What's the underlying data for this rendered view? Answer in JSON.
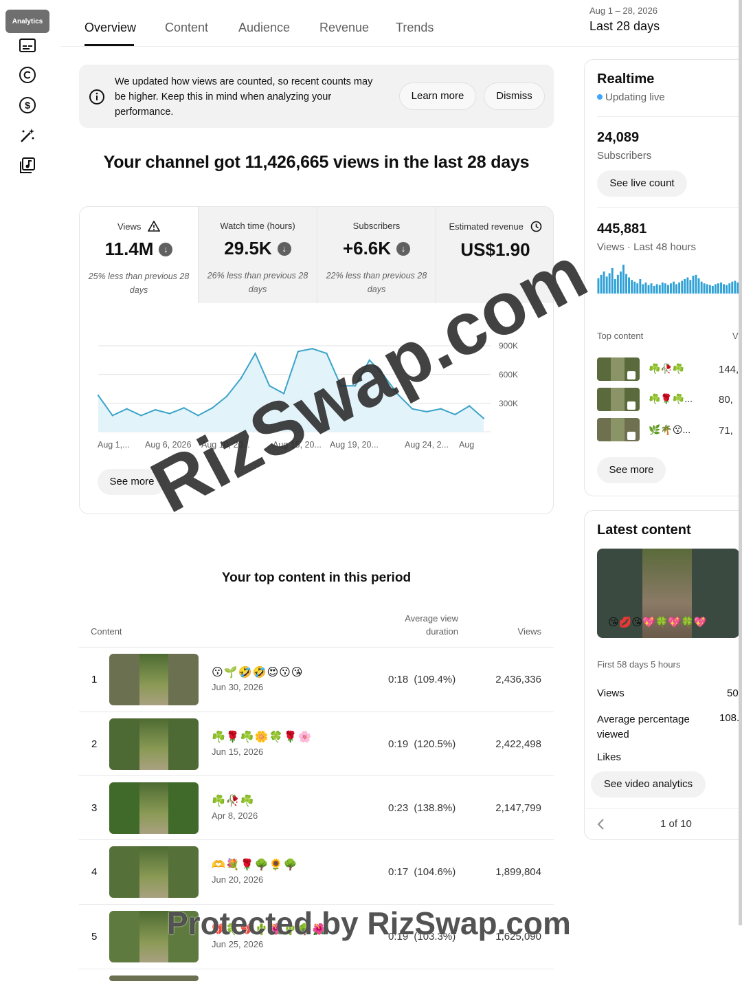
{
  "nav": {
    "active_label": "Analytics"
  },
  "tabs": [
    "Overview",
    "Content",
    "Audience",
    "Revenue",
    "Trends"
  ],
  "date_range": {
    "range": "Aug 1 – 28, 2026",
    "label": "Last 28 days"
  },
  "notice": {
    "text": "We updated how views are counted, so recent counts may be higher. Keep this in mind when analyzing your performance.",
    "learn_more": "Learn more",
    "dismiss": "Dismiss"
  },
  "headline": "Your channel got 11,426,665 views in the last 28 days",
  "metrics": [
    {
      "label": "Views",
      "value": "11.4M",
      "compare": "25% less than previous 28 days"
    },
    {
      "label": "Watch time (hours)",
      "value": "29.5K",
      "compare": "26% less than previous 28 days"
    },
    {
      "label": "Subscribers",
      "value": "+6.6K",
      "compare": "22% less than previous 28 days"
    },
    {
      "label": "Estimated revenue",
      "value": "US$1.90",
      "compare": ""
    }
  ],
  "chart_data": {
    "type": "area",
    "x": [
      "Aug 1",
      "Aug 2",
      "Aug 3",
      "Aug 4",
      "Aug 5",
      "Aug 6",
      "Aug 7",
      "Aug 8",
      "Aug 9",
      "Aug 10",
      "Aug 11",
      "Aug 12",
      "Aug 13",
      "Aug 14",
      "Aug 15",
      "Aug 16",
      "Aug 17",
      "Aug 18",
      "Aug 19",
      "Aug 20",
      "Aug 21",
      "Aug 22",
      "Aug 23",
      "Aug 24",
      "Aug 25",
      "Aug 26",
      "Aug 27",
      "Aug 28"
    ],
    "values": [
      380000,
      170000,
      240000,
      170000,
      230000,
      190000,
      250000,
      170000,
      250000,
      370000,
      560000,
      820000,
      480000,
      400000,
      840000,
      870000,
      820000,
      480000,
      480000,
      750000,
      590000,
      390000,
      240000,
      210000,
      240000,
      180000,
      270000,
      140000
    ],
    "ylim": [
      0,
      900000
    ],
    "yticks": [
      "900K",
      "600K",
      "300K"
    ],
    "xtick_labels": [
      "Aug 1,...",
      "Aug 6, 2026",
      "Aug 10, 20...",
      "Aug 15, 20...",
      "Aug 19, 20...",
      "Aug 24, 2...",
      "Aug"
    ],
    "grid": true
  },
  "chart_see_more": "See more",
  "top_content": {
    "title": "Your top content in this period",
    "headers": {
      "content": "Content",
      "avg": "Average view duration",
      "views": "Views"
    },
    "rows": [
      {
        "rank": "1",
        "title": "😗🌱🤣🤣😍😗😘",
        "date": "Jun 30, 2026",
        "duration": "0:18 (109.4%)",
        "views": "2,436,336"
      },
      {
        "rank": "2",
        "title": "☘️🌹☘️🌼🍀🌹🌸",
        "date": "Jun 15, 2026",
        "duration": "0:19 (120.5%)",
        "views": "2,422,498"
      },
      {
        "rank": "3",
        "title": "☘️🥀☘️",
        "date": "Apr 8, 2026",
        "duration": "0:23 (138.8%)",
        "views": "2,147,799"
      },
      {
        "rank": "4",
        "title": "🫶💐🌹🌳🌻🌳",
        "date": "Jun 20, 2026",
        "duration": "0:17 (104.6%)",
        "views": "1,899,804"
      },
      {
        "rank": "5",
        "title": "💔🍀💔🌵🌺🌵🌳🌺",
        "date": "Jun 25, 2026",
        "duration": "0:19 (103.3%)",
        "views": "1,625,090"
      }
    ]
  },
  "realtime": {
    "title": "Realtime",
    "status": "Updating live",
    "subs_value": "24,089",
    "subs_label": "Subscribers",
    "live_count": "See live count",
    "views_value": "445,881",
    "views_label": "Views · Last 48 hours",
    "spark": [
      18,
      22,
      26,
      20,
      24,
      30,
      17,
      22,
      26,
      34,
      23,
      19,
      16,
      14,
      12,
      17,
      11,
      13,
      10,
      12,
      9,
      11,
      10,
      13,
      12,
      10,
      12,
      14,
      11,
      13,
      15,
      17,
      19,
      16,
      21,
      22,
      18,
      14,
      12,
      11,
      10,
      9,
      11,
      12,
      13,
      11,
      10,
      12,
      14,
      15,
      13
    ],
    "top_content_label": "Top content",
    "top_content_col": "Vi",
    "top": [
      {
        "title": "☘️🥀☘️",
        "views": "144,"
      },
      {
        "title": "☘️🌹☘️...",
        "views": "80,"
      },
      {
        "title": "🌿🌴😗...",
        "views": "71,"
      }
    ],
    "see_more": "See more"
  },
  "latest": {
    "title": "Latest content",
    "overlay": "😘💋😘💖🍀💖🍀💖",
    "period": "First 58 days 5 hours",
    "stats": [
      {
        "label": "Views",
        "value": "50"
      },
      {
        "label": "Average percentage viewed",
        "value": "108."
      },
      {
        "label": "Likes",
        "value": ""
      }
    ],
    "analytics_btn": "See video analytics",
    "pager": "1 of 10"
  },
  "watermark": {
    "big": "RizSwap.com",
    "small": "Protected by RizSwap.com"
  }
}
